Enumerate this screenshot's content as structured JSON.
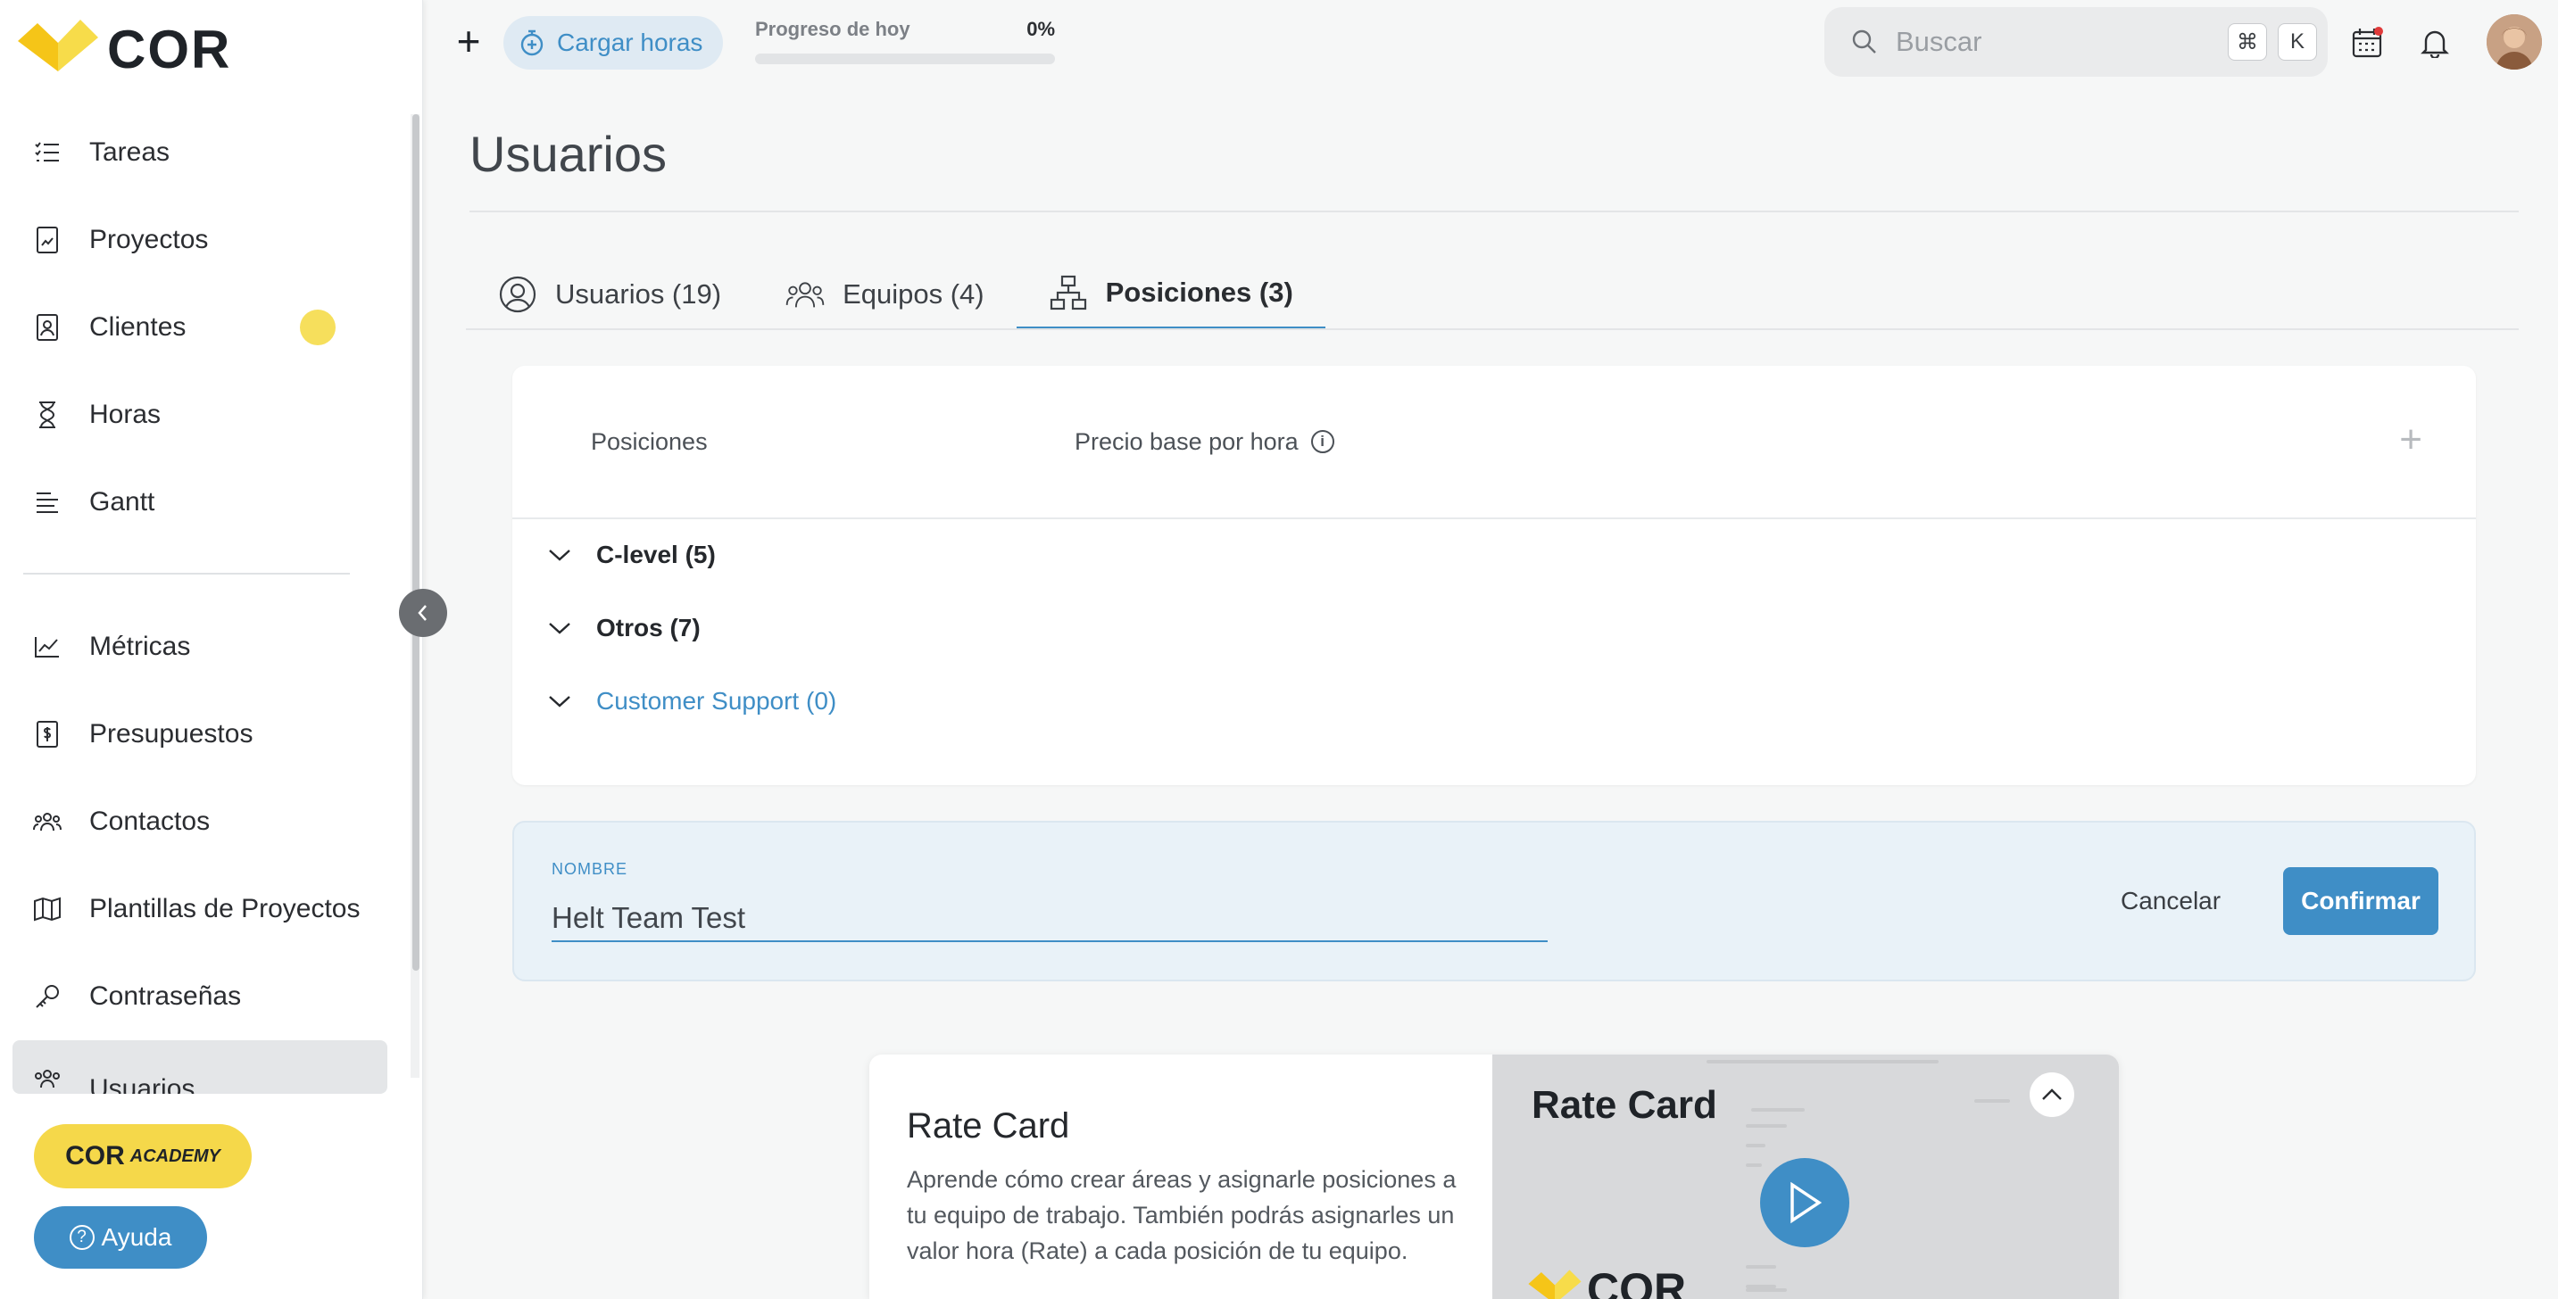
{
  "brand": {
    "name": "COR",
    "accent": "#3f8ec6",
    "yellow": "#f5d84a"
  },
  "sidebar": {
    "items": [
      {
        "label": "Tareas",
        "icon": "tasks-icon"
      },
      {
        "label": "Proyectos",
        "icon": "projects-icon"
      },
      {
        "label": "Clientes",
        "icon": "clients-icon"
      },
      {
        "label": "Horas",
        "icon": "hourglass-icon"
      },
      {
        "label": "Gantt",
        "icon": "gantt-icon"
      },
      {
        "label": "Métricas",
        "icon": "metrics-icon"
      },
      {
        "label": "Presupuestos",
        "icon": "budget-icon"
      },
      {
        "label": "Contactos",
        "icon": "contacts-icon"
      },
      {
        "label": "Plantillas de Proyectos",
        "icon": "map-icon"
      },
      {
        "label": "Contraseñas",
        "icon": "key-icon"
      },
      {
        "label": "Usuarios",
        "icon": "users-icon"
      }
    ],
    "academy_label": "COR",
    "academy_sub": "ACADEMY",
    "help_label": "Ayuda"
  },
  "topbar": {
    "load_hours_label": "Cargar horas",
    "progress_label": "Progreso de hoy",
    "progress_value": "0%",
    "progress_fraction": 0,
    "search_placeholder": "Buscar",
    "kbd_cmd": "⌘",
    "kbd_k": "K"
  },
  "page": {
    "title": "Usuarios",
    "tabs": [
      {
        "label": "Usuarios (19)"
      },
      {
        "label": "Equipos (4)"
      },
      {
        "label": "Posiciones (3)"
      }
    ]
  },
  "table": {
    "col_positions": "Posiciones",
    "col_price": "Precio base por hora",
    "info_glyph": "i",
    "add_glyph": "+",
    "groups": [
      {
        "label": "C-level (5)"
      },
      {
        "label": "Otros (7)"
      },
      {
        "label": "Customer Support (0)"
      }
    ]
  },
  "form": {
    "label": "NOMBRE",
    "value": "Helt Team Test",
    "cancel_label": "Cancelar",
    "confirm_label": "Confirmar"
  },
  "tutorial": {
    "title": "Rate Card",
    "description": "Aprende cómo crear áreas y asignarle posiciones a tu equipo de trabajo. También podrás asignarles un valor hora (Rate) a cada posición de tu equipo.",
    "video_title": "Rate Card",
    "video_logo_text": "COR"
  }
}
